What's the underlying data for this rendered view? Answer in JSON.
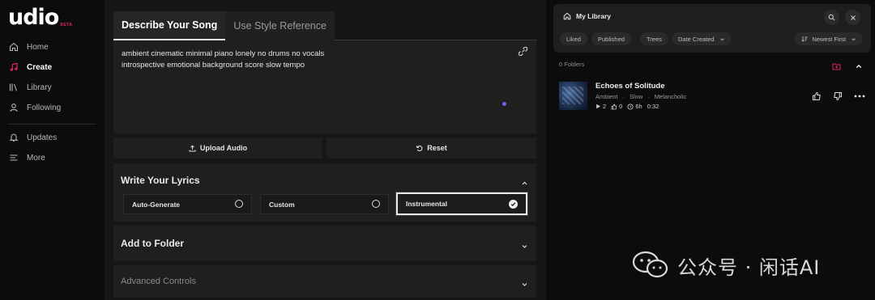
{
  "app": {
    "logo": "udio",
    "logo_badge": "BETA"
  },
  "sidebar": {
    "items": [
      {
        "label": "Home",
        "icon": "home-icon"
      },
      {
        "label": "Create",
        "icon": "music-note-icon",
        "active": true
      },
      {
        "label": "Library",
        "icon": "library-icon"
      },
      {
        "label": "Following",
        "icon": "user-icon"
      },
      {
        "label": "Updates",
        "icon": "bell-icon"
      },
      {
        "label": "More",
        "icon": "menu-icon"
      }
    ]
  },
  "create": {
    "tabs": [
      {
        "label": "Describe Your Song",
        "active": true
      },
      {
        "label": "Use Style Reference",
        "active": false
      }
    ],
    "prompt": {
      "line1": "ambient cinematic minimal piano lonely no drums no vocals",
      "line2": "introspective emotional background score slow tempo"
    },
    "upload_audio_label": "Upload Audio",
    "reset_label": "Reset",
    "lyrics": {
      "title": "Write Your Lyrics",
      "options": [
        {
          "label": "Auto-Generate",
          "selected": false
        },
        {
          "label": "Custom",
          "selected": false
        },
        {
          "label": "Instrumental",
          "selected": true
        }
      ]
    },
    "folder_title": "Add to Folder",
    "advanced_title": "Advanced Controls"
  },
  "library": {
    "title": "My Library",
    "filters": [
      "Liked",
      "Published",
      "Trees",
      "Date Created"
    ],
    "sort": "Newest First",
    "folders_count_label": "0 Folders",
    "songs": [
      {
        "title": "Echoes of Solitude",
        "tags": [
          "Ambient",
          "Slow",
          "Melancholic"
        ],
        "plays": "2",
        "likes": "0",
        "age": "6h",
        "duration": "0:32"
      }
    ]
  },
  "watermark": {
    "text": "公众号 · 闲话AI"
  },
  "colors": {
    "accent": "#e0245e",
    "purple": "#7c5cf2",
    "panel": "#1f1f1f",
    "bg": "#0c0c0c"
  }
}
